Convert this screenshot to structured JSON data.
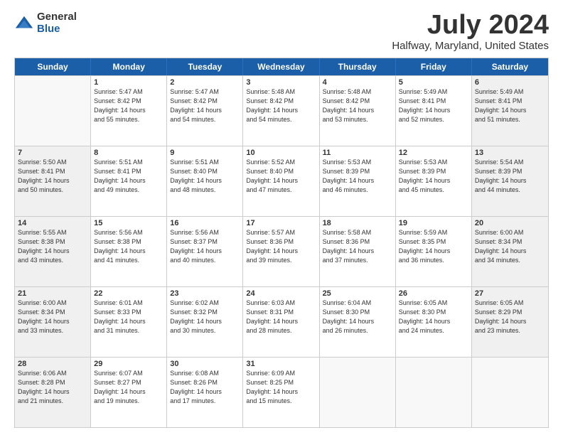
{
  "header": {
    "logo": {
      "general": "General",
      "blue": "Blue"
    },
    "title": "July 2024",
    "subtitle": "Halfway, Maryland, United States"
  },
  "weekdays": [
    "Sunday",
    "Monday",
    "Tuesday",
    "Wednesday",
    "Thursday",
    "Friday",
    "Saturday"
  ],
  "rows": [
    [
      {
        "day": "",
        "info": "",
        "empty": true
      },
      {
        "day": "1",
        "info": "Sunrise: 5:47 AM\nSunset: 8:42 PM\nDaylight: 14 hours\nand 55 minutes.",
        "shaded": false
      },
      {
        "day": "2",
        "info": "Sunrise: 5:47 AM\nSunset: 8:42 PM\nDaylight: 14 hours\nand 54 minutes.",
        "shaded": false
      },
      {
        "day": "3",
        "info": "Sunrise: 5:48 AM\nSunset: 8:42 PM\nDaylight: 14 hours\nand 54 minutes.",
        "shaded": false
      },
      {
        "day": "4",
        "info": "Sunrise: 5:48 AM\nSunset: 8:42 PM\nDaylight: 14 hours\nand 53 minutes.",
        "shaded": false
      },
      {
        "day": "5",
        "info": "Sunrise: 5:49 AM\nSunset: 8:41 PM\nDaylight: 14 hours\nand 52 minutes.",
        "shaded": false
      },
      {
        "day": "6",
        "info": "Sunrise: 5:49 AM\nSunset: 8:41 PM\nDaylight: 14 hours\nand 51 minutes.",
        "shaded": true
      }
    ],
    [
      {
        "day": "7",
        "info": "Sunrise: 5:50 AM\nSunset: 8:41 PM\nDaylight: 14 hours\nand 50 minutes.",
        "shaded": true
      },
      {
        "day": "8",
        "info": "Sunrise: 5:51 AM\nSunset: 8:41 PM\nDaylight: 14 hours\nand 49 minutes.",
        "shaded": false
      },
      {
        "day": "9",
        "info": "Sunrise: 5:51 AM\nSunset: 8:40 PM\nDaylight: 14 hours\nand 48 minutes.",
        "shaded": false
      },
      {
        "day": "10",
        "info": "Sunrise: 5:52 AM\nSunset: 8:40 PM\nDaylight: 14 hours\nand 47 minutes.",
        "shaded": false
      },
      {
        "day": "11",
        "info": "Sunrise: 5:53 AM\nSunset: 8:39 PM\nDaylight: 14 hours\nand 46 minutes.",
        "shaded": false
      },
      {
        "day": "12",
        "info": "Sunrise: 5:53 AM\nSunset: 8:39 PM\nDaylight: 14 hours\nand 45 minutes.",
        "shaded": false
      },
      {
        "day": "13",
        "info": "Sunrise: 5:54 AM\nSunset: 8:39 PM\nDaylight: 14 hours\nand 44 minutes.",
        "shaded": true
      }
    ],
    [
      {
        "day": "14",
        "info": "Sunrise: 5:55 AM\nSunset: 8:38 PM\nDaylight: 14 hours\nand 43 minutes.",
        "shaded": true
      },
      {
        "day": "15",
        "info": "Sunrise: 5:56 AM\nSunset: 8:38 PM\nDaylight: 14 hours\nand 41 minutes.",
        "shaded": false
      },
      {
        "day": "16",
        "info": "Sunrise: 5:56 AM\nSunset: 8:37 PM\nDaylight: 14 hours\nand 40 minutes.",
        "shaded": false
      },
      {
        "day": "17",
        "info": "Sunrise: 5:57 AM\nSunset: 8:36 PM\nDaylight: 14 hours\nand 39 minutes.",
        "shaded": false
      },
      {
        "day": "18",
        "info": "Sunrise: 5:58 AM\nSunset: 8:36 PM\nDaylight: 14 hours\nand 37 minutes.",
        "shaded": false
      },
      {
        "day": "19",
        "info": "Sunrise: 5:59 AM\nSunset: 8:35 PM\nDaylight: 14 hours\nand 36 minutes.",
        "shaded": false
      },
      {
        "day": "20",
        "info": "Sunrise: 6:00 AM\nSunset: 8:34 PM\nDaylight: 14 hours\nand 34 minutes.",
        "shaded": true
      }
    ],
    [
      {
        "day": "21",
        "info": "Sunrise: 6:00 AM\nSunset: 8:34 PM\nDaylight: 14 hours\nand 33 minutes.",
        "shaded": true
      },
      {
        "day": "22",
        "info": "Sunrise: 6:01 AM\nSunset: 8:33 PM\nDaylight: 14 hours\nand 31 minutes.",
        "shaded": false
      },
      {
        "day": "23",
        "info": "Sunrise: 6:02 AM\nSunset: 8:32 PM\nDaylight: 14 hours\nand 30 minutes.",
        "shaded": false
      },
      {
        "day": "24",
        "info": "Sunrise: 6:03 AM\nSunset: 8:31 PM\nDaylight: 14 hours\nand 28 minutes.",
        "shaded": false
      },
      {
        "day": "25",
        "info": "Sunrise: 6:04 AM\nSunset: 8:30 PM\nDaylight: 14 hours\nand 26 minutes.",
        "shaded": false
      },
      {
        "day": "26",
        "info": "Sunrise: 6:05 AM\nSunset: 8:30 PM\nDaylight: 14 hours\nand 24 minutes.",
        "shaded": false
      },
      {
        "day": "27",
        "info": "Sunrise: 6:05 AM\nSunset: 8:29 PM\nDaylight: 14 hours\nand 23 minutes.",
        "shaded": true
      }
    ],
    [
      {
        "day": "28",
        "info": "Sunrise: 6:06 AM\nSunset: 8:28 PM\nDaylight: 14 hours\nand 21 minutes.",
        "shaded": true
      },
      {
        "day": "29",
        "info": "Sunrise: 6:07 AM\nSunset: 8:27 PM\nDaylight: 14 hours\nand 19 minutes.",
        "shaded": false
      },
      {
        "day": "30",
        "info": "Sunrise: 6:08 AM\nSunset: 8:26 PM\nDaylight: 14 hours\nand 17 minutes.",
        "shaded": false
      },
      {
        "day": "31",
        "info": "Sunrise: 6:09 AM\nSunset: 8:25 PM\nDaylight: 14 hours\nand 15 minutes.",
        "shaded": false
      },
      {
        "day": "",
        "info": "",
        "empty": true
      },
      {
        "day": "",
        "info": "",
        "empty": true
      },
      {
        "day": "",
        "info": "",
        "empty": true
      }
    ]
  ]
}
